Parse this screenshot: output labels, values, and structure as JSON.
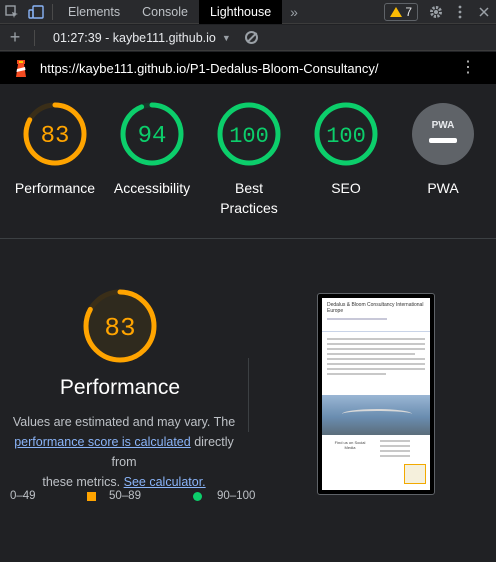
{
  "devtools": {
    "tabs": [
      "Elements",
      "Console",
      "Lighthouse"
    ],
    "active_tab": "Lighthouse",
    "warning_count": "7"
  },
  "toolbar": {
    "report_label": "01:27:39 - kaybe111.github.io"
  },
  "url": "https://kaybe111.github.io/P1-Dedalus-Bloom-Consultancy/",
  "gauges": [
    {
      "label": "Performance",
      "score": "83",
      "value": 83,
      "color": "#ffa400"
    },
    {
      "label": "Accessibility",
      "score": "94",
      "value": 94,
      "color": "#0cce6b"
    },
    {
      "label_line1": "Best",
      "label_line2": "Practices",
      "score": "100",
      "value": 100,
      "color": "#0cce6b"
    },
    {
      "label": "SEO",
      "score": "100",
      "value": 100,
      "color": "#0cce6b"
    },
    {
      "label": "PWA",
      "badge_text": "PWA"
    }
  ],
  "performance": {
    "score": "83",
    "value": 83,
    "color": "#ffa400",
    "title": "Performance",
    "desc_part1": "Values are estimated and may vary. The",
    "link1": "performance score is calculated",
    "desc_part2": "directly from",
    "desc_part3": "these metrics.",
    "link2": "See calculator."
  },
  "legend": {
    "low": "0–49",
    "mid": "50–89",
    "high": "90–100"
  },
  "thumbnail": {
    "title": "Dedalus & Bloom Consultancy International Europe",
    "social_label": "Find us on Social Media"
  },
  "colors": {
    "pass": "#0cce6b",
    "average": "#ffa400",
    "link": "#8ab4f8"
  }
}
